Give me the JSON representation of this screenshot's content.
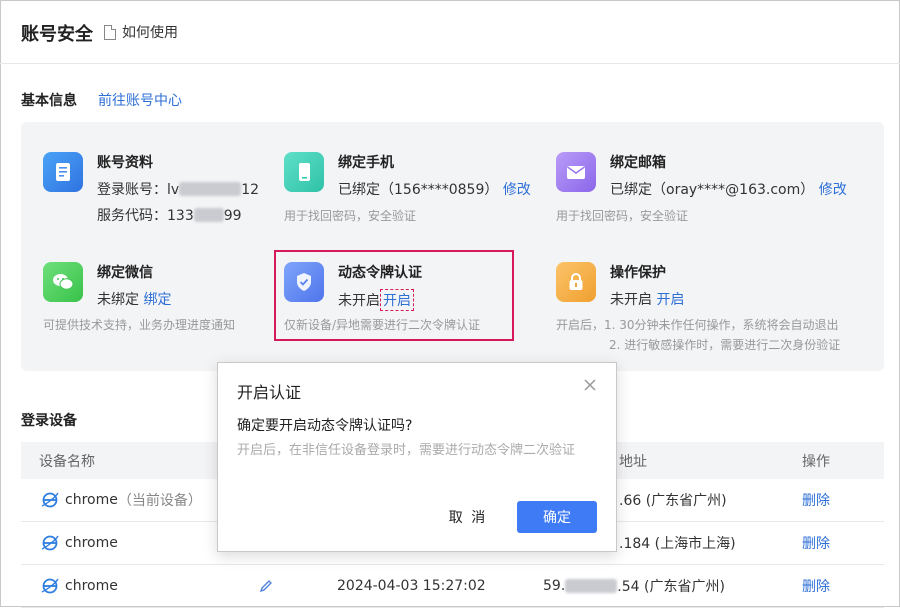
{
  "header": {
    "title": "账号安全",
    "howto": "如何使用"
  },
  "basic": {
    "title": "基本信息",
    "goto_link": "前往账号中心",
    "cards": {
      "profile": {
        "title": "账号资料",
        "line1_label": "登录账号：",
        "line1_pre": "lv",
        "line1_post": "12",
        "line2_label": "服务代码：",
        "line2_pre": "133",
        "line2_post": "99"
      },
      "phone": {
        "title": "绑定手机",
        "status": "已绑定",
        "value": "（156****0859）",
        "action": "修改",
        "hint": "用于找回密码，安全验证"
      },
      "email": {
        "title": "绑定邮箱",
        "status": "已绑定",
        "value": "（oray****@163.com）",
        "action": "修改",
        "hint": "用于找回密码，安全验证"
      },
      "wechat": {
        "title": "绑定微信",
        "status": "未绑定",
        "action": "绑定",
        "hint": "可提供技术支持，业务办理进度通知"
      },
      "otp": {
        "title": "动态令牌认证",
        "status": "未开启",
        "action": "开启",
        "hint": "仅新设备/异地需要进行二次令牌认证"
      },
      "protect": {
        "title": "操作保护",
        "status": "未开启",
        "action": "开启",
        "hint1": "开启后，1. 30分钟未作任何操作，系统将会自动退出",
        "hint2": "2. 进行敏感操作时，需要进行二次身份验证"
      }
    }
  },
  "devices": {
    "title": "登录设备",
    "columns": {
      "name": "设备名称",
      "address": "地址",
      "ops": "操作"
    },
    "rows": [
      {
        "name": "chrome",
        "note": "（当前设备）",
        "time": "",
        "ip_pre": "",
        "ip_post": ".66 (广东省广州)",
        "op": "删除"
      },
      {
        "name": "chrome",
        "note": "",
        "time": "",
        "ip_pre": "",
        "ip_post": ".184 (上海市上海)",
        "op": "删除"
      },
      {
        "name": "chrome",
        "note": "",
        "time": "2024-04-03 15:27:02",
        "ip_pre": "59.",
        "ip_post": ".54 (广东省广州)",
        "op": "删除"
      }
    ]
  },
  "dialog": {
    "title": "开启认证",
    "question": "确定要开启动态令牌认证吗?",
    "desc": "开启后，在非信任设备登录时，需要进行动态令牌二次验证",
    "cancel": "取 消",
    "ok": "确定"
  },
  "colors": {
    "link": "#2e6fd6",
    "primary": "#3e7bf5",
    "highlight": "#d6195a"
  }
}
